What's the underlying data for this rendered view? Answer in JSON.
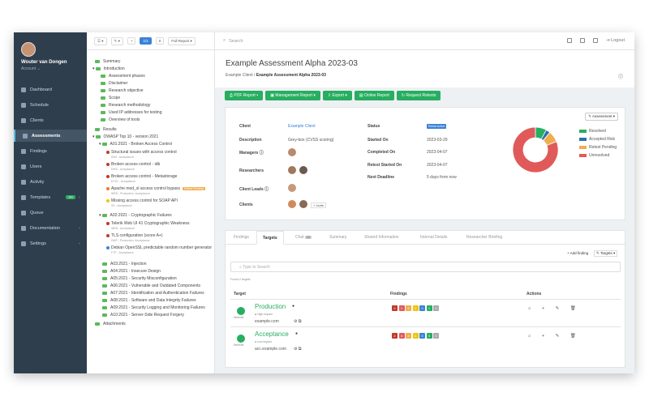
{
  "user": {
    "name": "Wouter van Dongen",
    "account": "Account"
  },
  "nav": [
    "Dashboard",
    "Schedule",
    "Clients",
    "Assessments",
    "Findings",
    "Users",
    "Activity",
    "Templates",
    "Queue",
    "Documentation",
    "Settings"
  ],
  "templates_badge": "PR",
  "toolbar": {
    "count": "1/1",
    "zero": "0",
    "report": "Full Report"
  },
  "tree": {
    "summary": "Summary",
    "intro": "Introduction",
    "intro_items": [
      "Assessment phases",
      "Disclaimer",
      "Research objective",
      "Scope",
      "Research methodology",
      "Used IP addresses for testing",
      "Overview of tools"
    ],
    "results": "Results",
    "owasp": "OWASP Top 10 - version 2021",
    "a01": "A01:2021 - Broken Access Control",
    "a01_findings": [
      "Structural issues with access control",
      "Broken access control - idb",
      "Broken access control - Metastorage",
      "Apache mod_sl access control bypass",
      "Missing access control for SOAP API"
    ],
    "a01_subs": [
      "IDW - Acceptance",
      "DMS - Acceptance",
      "DTSL - Acceptance",
      "WEB - Production, Acceptance",
      "IDI - Acceptance"
    ],
    "pending": "Retest Pending",
    "a02": "A02:2021 - Cryptographic Failures",
    "a02_findings": [
      "Telerik Web UI 41 Cryptographic Weakness",
      "TLS configuration (score A+)",
      "Debian OpenSSL predictable random number generator"
    ],
    "a02_subs": [
      "WEB - Acceptance",
      "DMP - Production, Acceptance",
      "FTP - Acceptance"
    ],
    "rest": [
      "A03:2021 - Injection",
      "A04:2021 - Insecure Design",
      "A05:2021 - Security Misconfiguration",
      "A06:2021 - Vulnerable and Outdated Components",
      "A07:2021 - Identification and Authentication Failures",
      "A08:2021 - Software and Data Integrity Failures",
      "A09:2021 - Security Logging and Monitoring Failures",
      "A10:2021 - Server-Side Request Forgery"
    ],
    "attachments": "Attachments"
  },
  "topbar": {
    "search": "Search",
    "logout": "Logout",
    "b1": "2",
    "b2": "4"
  },
  "page": {
    "title": "Example Assessment Alpha 2023-03",
    "crumb1": "Example Client",
    "crumb2": "Example Assessment Alpha 2023-03"
  },
  "buttons": [
    "PDF Report",
    "Management Report",
    "Export",
    "Online Report",
    "Request Retests"
  ],
  "info": {
    "client_l": "Client",
    "client_v": "Example Client",
    "desc_l": "Description",
    "desc_v": "Grey-box (CVSS scoring)",
    "managers_l": "Managers",
    "researchers_l": "Researchers",
    "leads_l": "Client Leads",
    "clients_l": "Clients",
    "invite": "Invite",
    "status_l": "Status",
    "status_v": "Retest Active",
    "started_l": "Started On",
    "started_v": "2023-03-29",
    "completed_l": "Completed On",
    "completed_v": "2023-04-07",
    "retest_l": "Retest Started On",
    "retest_v": "2023-04-07",
    "deadline_l": "Next Deadline",
    "deadline_v": "5 days from now",
    "assessment_dd": "Assessment"
  },
  "chart_data": {
    "type": "pie",
    "categories": [
      "Resolved",
      "Accepted Risk",
      "Retest Pending",
      "Unresolved"
    ],
    "values": [
      8,
      3,
      8,
      81
    ],
    "colors": [
      "#27ae60",
      "#2c6fb0",
      "#f0ad4e",
      "#e05a5a"
    ]
  },
  "tabs": [
    "Findings",
    "Targets",
    "Chat",
    "Summary",
    "Shared Information",
    "Internal Details",
    "Researcher Briefing"
  ],
  "chat_count": "20",
  "targets": {
    "add_finding": "Add finding",
    "targets_dd": "Targets",
    "search_placeholder": "Type to Search",
    "found": "Found 2 targets",
    "h_target": "Target",
    "h_findings": "Findings",
    "h_actions": "Actions",
    "rows": [
      {
        "name": "Production",
        "impact": "High impact",
        "host": "example.com",
        "type": "Website",
        "counts": [
          "0",
          "1",
          "2",
          "1",
          "0",
          "1",
          "0"
        ]
      },
      {
        "name": "Acceptance",
        "impact": "Low impact",
        "host": "acc.example.com",
        "type": "Website",
        "counts": [
          "2",
          "4",
          "2",
          "1",
          "0",
          "0",
          "0"
        ]
      }
    ],
    "actions": "⌂ + ✎ 🗑"
  }
}
